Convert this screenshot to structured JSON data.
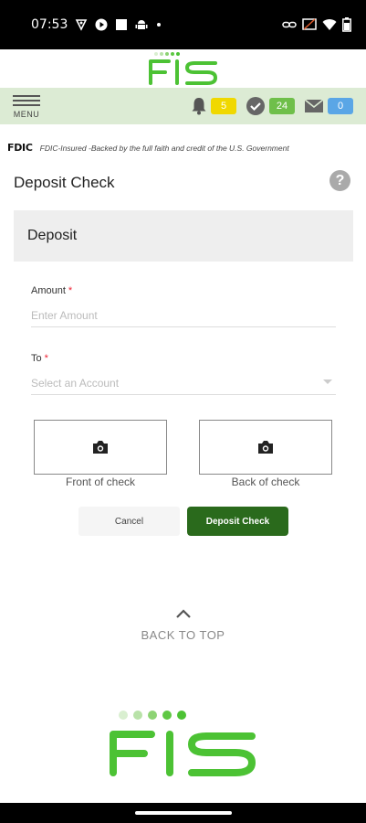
{
  "status_bar": {
    "time": "07:53",
    "left_icons": [
      "vpn-icon",
      "play-icon",
      "square-icon",
      "android-icon",
      "dot-icon"
    ],
    "right_icons": [
      "link-icon",
      "cast-off-icon",
      "wifi-icon",
      "battery-icon"
    ]
  },
  "brand": {
    "name": "FIS",
    "color": "#4cc234",
    "dot_colors": [
      "#d9efd0",
      "#b8e2a8",
      "#8dd374",
      "#5fc844",
      "#4cc234"
    ]
  },
  "nav": {
    "menu_label": "MENU",
    "notifications": {
      "count": "5",
      "badge_color": "#f0d800"
    },
    "tasks": {
      "count": "24",
      "badge_color": "#6fbf4a"
    },
    "messages": {
      "count": "0",
      "badge_color": "#5aa6e6"
    }
  },
  "fdic": {
    "logo": "FDIC",
    "text": "FDIC-Insured -Backed by the full faith and credit of the U.S. Government"
  },
  "page": {
    "title": "Deposit Check",
    "help_icon": "?",
    "section_title": "Deposit"
  },
  "form": {
    "amount_label": "Amount",
    "amount_placeholder": "Enter Amount",
    "to_label": "To",
    "to_placeholder": "Select an Account",
    "required_marker": "*",
    "front_caption": "Front of check",
    "back_caption": "Back of check",
    "cancel_label": "Cancel",
    "deposit_label": "Deposit Check"
  },
  "footer": {
    "back_to_top": "BACK TO TOP"
  }
}
